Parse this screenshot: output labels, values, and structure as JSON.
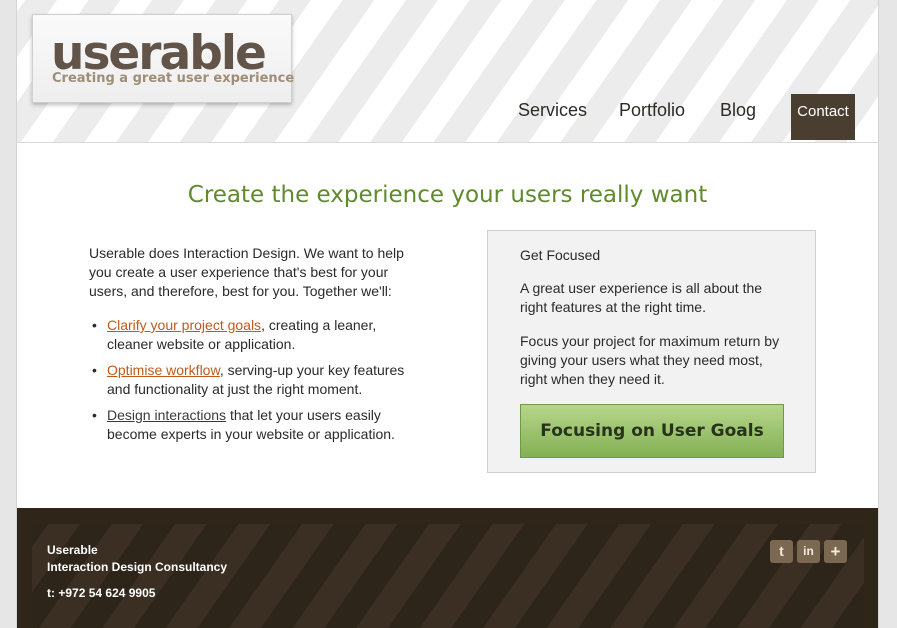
{
  "logo": {
    "word": "userable",
    "tagline": "Creating a great user experience"
  },
  "nav": {
    "services": "Services",
    "portfolio": "Portfolio",
    "blog": "Blog",
    "contact": "Contact"
  },
  "headline": "Create the experience your users really want",
  "intro": "Userable does Interaction Design. We want to help you create a user experience that's best for your users, and therefore, best for you. Together we'll:",
  "bullets": [
    {
      "link": "Clarify your project goals",
      "rest": ", creating a leaner, cleaner website or application."
    },
    {
      "link": "Optimise workflow",
      "rest": ", serving-up your key features and functionality at just the right moment."
    },
    {
      "link": "Design interactions",
      "rest": " that let your users easily become experts in your website or application."
    }
  ],
  "focus": {
    "title": "Get Focused",
    "p1": "A great user experience is all about the right features at the right time.",
    "p2": "Focus your project for maximum return by giving your users what they need most, right when they need it.",
    "button": "Focusing on User Goals"
  },
  "footer": {
    "company": "Userable",
    "subtitle": "Interaction Design Consultancy",
    "phone_label": "t:",
    "phone": "+972 54 624 9905"
  },
  "social": [
    {
      "icon": "twitter-icon",
      "glyph": "t"
    },
    {
      "icon": "linkedin-icon",
      "glyph": "in"
    },
    {
      "icon": "plus-icon",
      "glyph": "+"
    }
  ],
  "colors": {
    "accent_green": "#5f8a2e",
    "link_orange": "#c05a1a",
    "nav_dark": "#4a3e30",
    "footer_bg": "#2f2519"
  }
}
